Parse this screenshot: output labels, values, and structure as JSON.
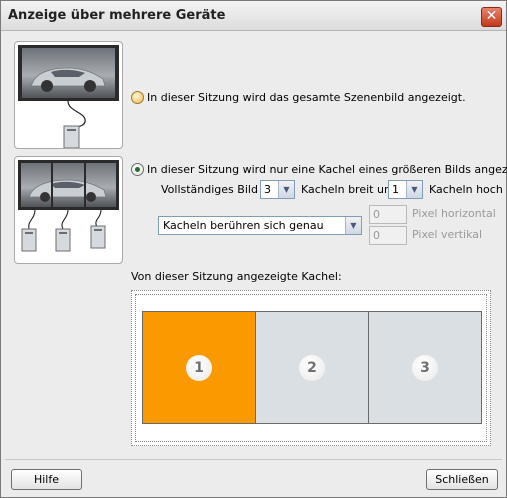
{
  "window": {
    "title": "Anzeige über mehrere Geräte",
    "close_glyph": "✕"
  },
  "option_full": {
    "label": "In dieser Sitzung wird das gesamte Szenenbild angezeigt.",
    "selected": false
  },
  "option_tile": {
    "label": "In dieser Sitzung wird nur eine Kachel eines größeren Bilds angezeigt.",
    "selected": true
  },
  "size_row": {
    "prefix": "Vollständiges Bild ist",
    "width_value": "3",
    "middle": "Kacheln breit und",
    "height_value": "1",
    "suffix": "Kacheln hoch"
  },
  "overlap": {
    "selected": "Kacheln berühren sich genau",
    "pixel_h_value": "0",
    "pixel_h_label": "Pixel horizontal",
    "pixel_v_value": "0",
    "pixel_v_label": "Pixel vertikal"
  },
  "tiles": {
    "heading": "Von dieser Sitzung angezeigte Kachel:",
    "items": [
      {
        "number": "1",
        "selected": true
      },
      {
        "number": "2",
        "selected": false
      },
      {
        "number": "3",
        "selected": false
      }
    ],
    "selected_color": "#FB9A00"
  },
  "footer": {
    "help_label": "Hilfe",
    "close_label": "Schließen"
  },
  "icons": {
    "single": "monitor-with-car-and-one-tower-icon",
    "multi": "three-monitors-with-car-and-three-towers-icon",
    "dropdown": "chevron-down-icon"
  }
}
